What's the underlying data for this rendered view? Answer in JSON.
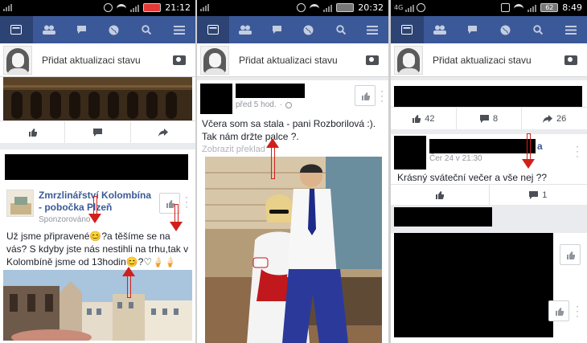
{
  "phones": [
    {
      "status": {
        "time": "21:12",
        "battery": ""
      },
      "status_prompt": "Přidat aktualizaci stavu",
      "sponsored_post": {
        "page_name": "Zmrzlinářství Kolombína - pobočka Plzeň",
        "label": "Sponzorováno",
        "text": "Už jsme připravené😊?a těšíme se na vás? S kdyby jste nás nestihli na trhu,tak v Kolombíně jsme od 13hodin😊?♡🍦🍦"
      }
    },
    {
      "status": {
        "time": "20:32",
        "battery": ""
      },
      "status_prompt": "Přidat aktualizaci stavu",
      "post": {
        "time": "před 5 hod.",
        "text": "Včera som sa stala - pani Rozborilová :). Tak nám držte palce ?.",
        "translate": "Zobrazit překlad"
      }
    },
    {
      "status": {
        "time": "8:49",
        "battery": "62"
      },
      "status_prompt": "Přidat aktualizaci stavu",
      "counts": {
        "likes": "42",
        "comments": "8",
        "shares": "26"
      },
      "post": {
        "time": "Čer 24 v 21:30",
        "name_tail": "a",
        "text": "Krásný sváteční večer a vše nej ??",
        "comments": "1"
      }
    }
  ],
  "icons": {
    "nav": [
      "news-feed-icon",
      "friends-icon",
      "messages-icon",
      "globe-icon",
      "search-icon",
      "menu-icon"
    ]
  },
  "colors": {
    "facebook_blue": "#3b5998",
    "arrow_red": "#d0201b"
  }
}
